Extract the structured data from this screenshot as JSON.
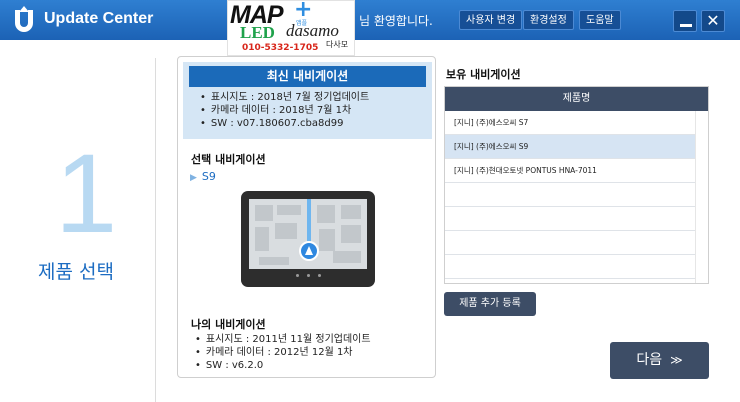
{
  "titlebar": {
    "title": "Update Center",
    "brand": {
      "map": "MAP",
      "plus": "+",
      "app_sub": "앱플",
      "led": "LED",
      "dasamo": "dasamo",
      "dasamo_kr": "다사모",
      "phone": "010-5332-1705"
    },
    "welcome": "님 환영합니다.",
    "buttons": [
      "사용자 변경",
      "환경설정",
      "도움말"
    ],
    "accent": "#1c62b5"
  },
  "step": {
    "number": "1",
    "label": "제품 선택"
  },
  "latest": {
    "title": "최신 내비게이션",
    "items": [
      "표시지도 : 2018년 7월 정기업데이트",
      "카메라 데이터 : 2018년 7월 1차",
      "SW : v07.180607.cba8d99"
    ]
  },
  "selected": {
    "title": "선택 내비게이션",
    "model": "S9"
  },
  "mine": {
    "title": "나의 내비게이션",
    "items": [
      "표시지도 : 2011년 11월 정기업데이트",
      "카메라 데이터 : 2012년 12월 1차",
      "SW : v6.2.0"
    ]
  },
  "owned": {
    "title": "보유 내비게이션",
    "column": "제품명",
    "rows": [
      "[지니] (주)에스오씨 S7",
      "[지니] (주)에스오씨 S9",
      "[지니] (주)현대오토넷 PONTUS HNA-7011"
    ],
    "selected_index": 1,
    "add_button": "제품 추가 등록"
  },
  "next_button": {
    "label": "다음",
    "icon": "double-chevron-down-icon"
  }
}
